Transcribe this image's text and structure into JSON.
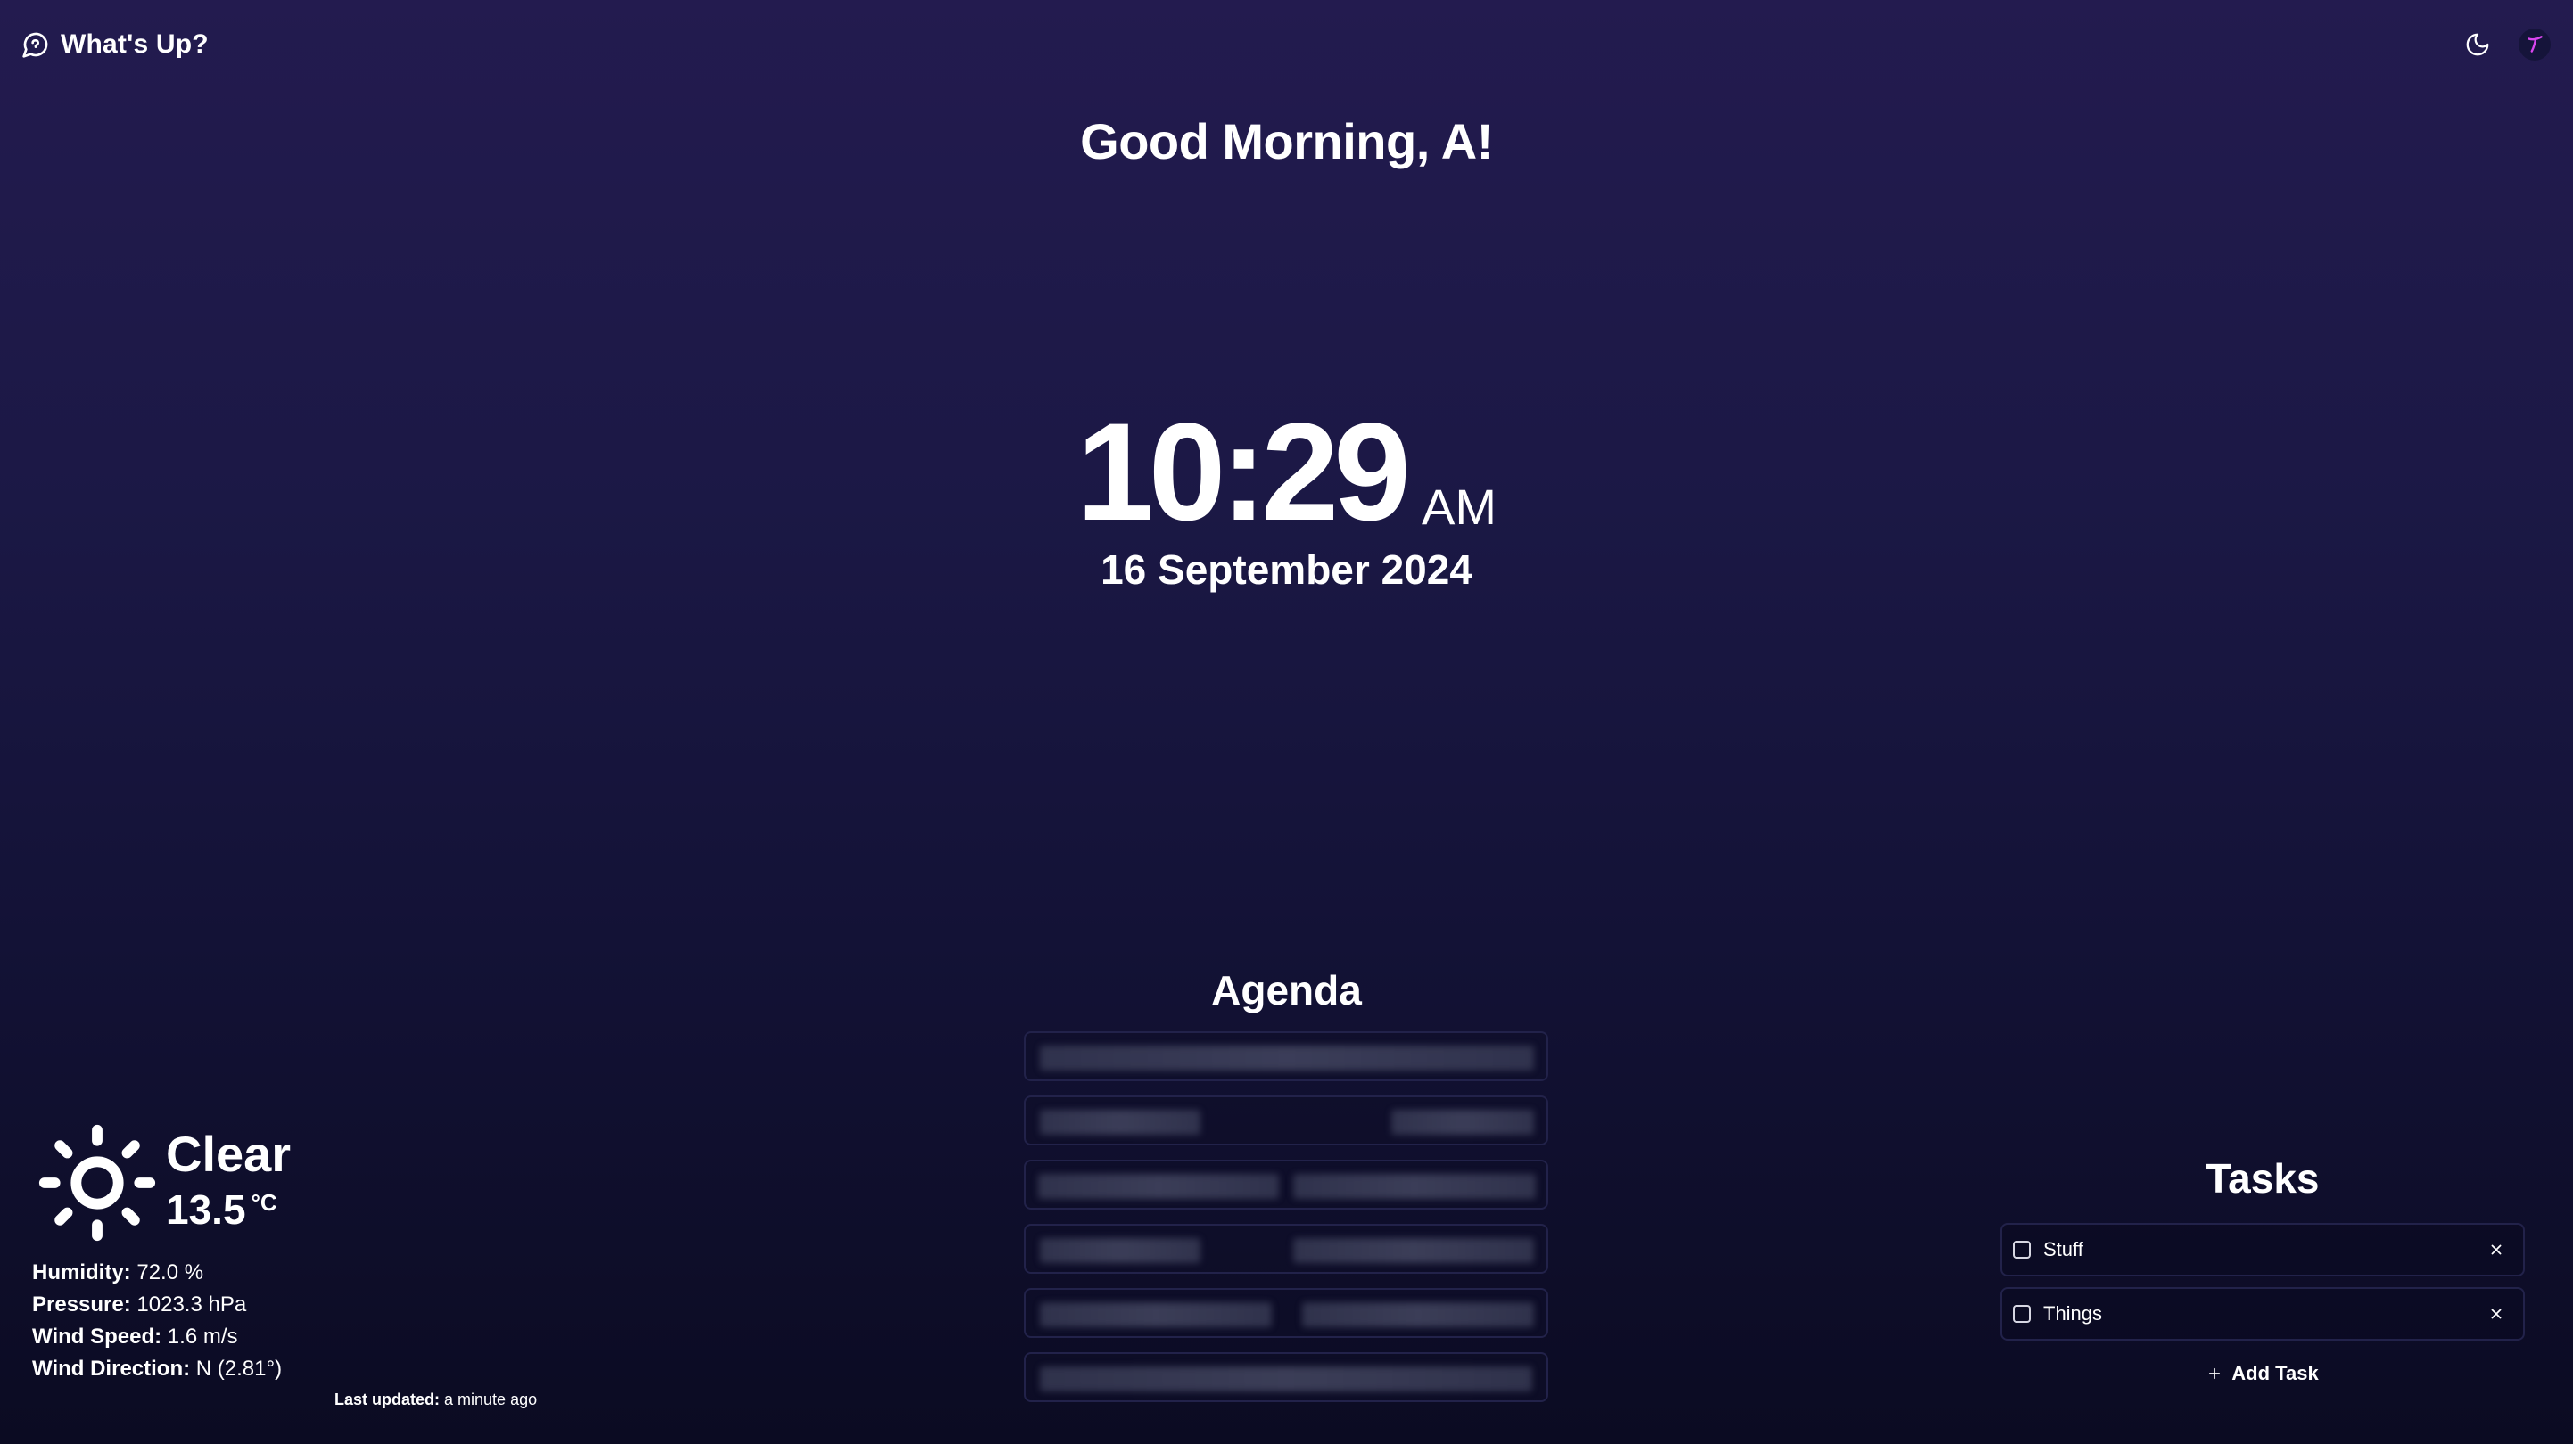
{
  "header": {
    "brand_name": "What's Up?",
    "brand_icon": "message-circle-icon",
    "theme_toggle_icon": "moon-icon",
    "avatar_icon": "t-logo-icon",
    "avatar_color": "#d946ef"
  },
  "greeting": "Good Morning, A!",
  "clock": {
    "time": "10:29",
    "ampm": "AM",
    "date": "16 September 2024"
  },
  "agenda": {
    "title": "Agenda",
    "items_count_note": "",
    "items": [
      {
        "redacted": true
      },
      {
        "redacted": true
      },
      {
        "redacted": true
      },
      {
        "redacted": true
      },
      {
        "redacted": true
      },
      {
        "redacted": true
      }
    ]
  },
  "weather": {
    "icon": "sun-icon",
    "condition": "Clear",
    "temperature": "13.5",
    "unit": "°C",
    "humidity_label": "Humidity:",
    "humidity_value": "72.0 %",
    "pressure_label": "Pressure:",
    "pressure_value": "1023.3 hPa",
    "wind_speed_label": "Wind Speed:",
    "wind_speed_value": "1.6 m/s",
    "wind_direction_label": "Wind Direction:",
    "wind_direction_value": "N (2.81°)",
    "last_updated_label": "Last updated:",
    "last_updated_value": "a minute ago"
  },
  "tasks": {
    "title": "Tasks",
    "items": [
      {
        "label": "Stuff",
        "checked": false
      },
      {
        "label": "Things",
        "checked": false
      }
    ],
    "add_label": "Add Task"
  },
  "colors": {
    "background_top": "#231b4f",
    "background_bottom": "#0b0b22",
    "text": "#ffffff",
    "card_border": "#22224a"
  }
}
